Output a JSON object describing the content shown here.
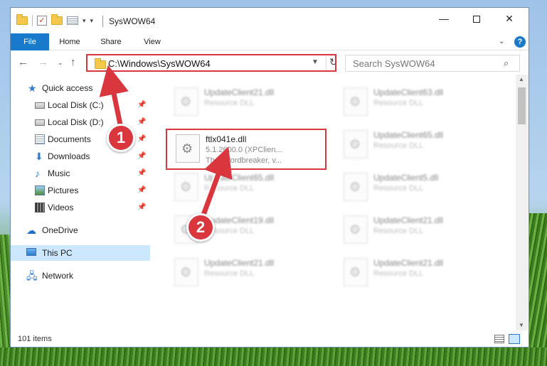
{
  "window": {
    "title": "SysWOW64",
    "controls": {
      "minimize": "—",
      "maximize": "□",
      "close": "✕"
    }
  },
  "ribbon": {
    "tabs": [
      "File",
      "Home",
      "Share",
      "View"
    ],
    "help": "?"
  },
  "address": {
    "path": "C:\\Windows\\SysWOW64",
    "search_placeholder": "Search SysWOW64"
  },
  "sidebar": {
    "items": [
      {
        "label": "Quick access",
        "icon": "star-icon",
        "pinned": false
      },
      {
        "label": "Local Disk (C:)",
        "icon": "disk-icon",
        "pinned": true
      },
      {
        "label": "Local Disk (D:)",
        "icon": "disk-icon",
        "pinned": true
      },
      {
        "label": "Documents",
        "icon": "documents-icon",
        "pinned": true
      },
      {
        "label": "Downloads",
        "icon": "download-icon",
        "pinned": true
      },
      {
        "label": "Music",
        "icon": "music-icon",
        "pinned": true
      },
      {
        "label": "Pictures",
        "icon": "pictures-icon",
        "pinned": true
      },
      {
        "label": "Videos",
        "icon": "videos-icon",
        "pinned": true
      },
      {
        "label": "OneDrive",
        "icon": "cloud-icon",
        "pinned": false
      },
      {
        "label": "This PC",
        "icon": "computer-icon",
        "pinned": false,
        "selected": true
      },
      {
        "label": "Network",
        "icon": "network-icon",
        "pinned": false
      }
    ]
  },
  "files": {
    "focused": {
      "name": "ftlx041e.dll",
      "version": "5.1.2600.0 (XPClien...",
      "description": "Thai Wordbreaker, v..."
    },
    "background": [
      {
        "name": "UpdateClient21.dll",
        "type": "Resource DLL"
      },
      {
        "name": "UpdateClient63.dll",
        "type": "Resource DLL"
      },
      {
        "name": "UpdateClient65.dll",
        "type": "Resource DLL"
      },
      {
        "name": "UpdateClient65.dll",
        "type": "Resource DLL"
      },
      {
        "name": "UpdateClient5.dll",
        "type": "Resource DLL"
      },
      {
        "name": "UpdateClient19.dll",
        "type": "Resource DLL"
      },
      {
        "name": "UpdateClient21.dll",
        "type": "Resource DLL"
      },
      {
        "name": "UpdateClient21.dll",
        "type": "Resource DLL"
      },
      {
        "name": "UpdateClient21.dll",
        "type": "Resource DLL"
      }
    ]
  },
  "status": {
    "item_count": "101 items"
  },
  "annotations": {
    "step1": "1",
    "step2": "2",
    "color": "#d9363e"
  }
}
